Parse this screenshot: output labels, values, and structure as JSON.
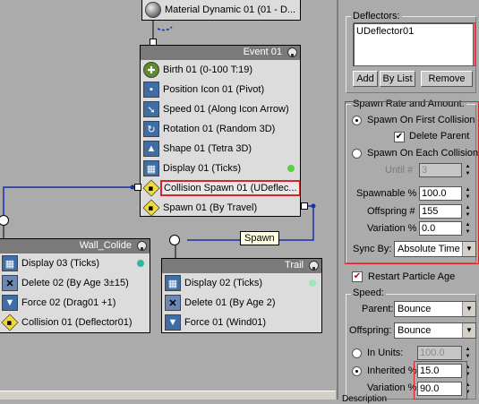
{
  "canvas": {
    "top_node": {
      "label": "Material Dynamic 01 (01 - D..."
    },
    "event_node": {
      "title": "Event 01",
      "operators": [
        {
          "label": "Birth 01 (0-100 T:19)",
          "icon": "birth-icon"
        },
        {
          "label": "Position Icon 01 (Pivot)",
          "icon": "position-icon"
        },
        {
          "label": "Speed 01 (Along Icon Arrow)",
          "icon": "speed-icon"
        },
        {
          "label": "Rotation 01 (Random 3D)",
          "icon": "rotation-icon"
        },
        {
          "label": "Shape 01 (Tetra 3D)",
          "icon": "shape-icon"
        },
        {
          "label": "Display 01 (Ticks)",
          "icon": "display-icon",
          "dot_color": "#5ccf3e"
        },
        {
          "label": "Collision Spawn 01 (UDeflec...",
          "icon": "collision-spawn-icon",
          "selected": true
        },
        {
          "label": "Spawn 01 (By Travel)",
          "icon": "spawn-icon"
        }
      ]
    },
    "wall_node": {
      "title": "Wall_Colide",
      "operators": [
        {
          "label": "Display 03 (Ticks)",
          "icon": "display-icon",
          "dot_color": "#2fb7a2"
        },
        {
          "label": "Delete 02 (By Age 3±15)",
          "icon": "delete-icon"
        },
        {
          "label": "Force 02 (Drag01 +1)",
          "icon": "force-icon"
        },
        {
          "label": "Collision 01 (Deflector01)",
          "icon": "collision-icon"
        }
      ]
    },
    "trail_node": {
      "title": "Trail",
      "operators": [
        {
          "label": "Display 02 (Ticks)",
          "icon": "display-icon",
          "dot_color": "#9be8b6"
        },
        {
          "label": "Delete 01 (By Age 2)",
          "icon": "delete-icon"
        },
        {
          "label": "Force 01 (Wind01)",
          "icon": "force-icon"
        }
      ]
    },
    "tooltip": "Spawn"
  },
  "panel": {
    "deflectors": {
      "title": "Deflectors:",
      "items": [
        "UDeflector01"
      ],
      "add_label": "Add",
      "by_list_label": "By List",
      "remove_label": "Remove"
    },
    "spawn_rate": {
      "title": "Spawn Rate and Amount:",
      "first_collision_label": "Spawn On First Collision",
      "delete_parent_label": "Delete Parent",
      "each_collision_label": "Spawn On Each Collision",
      "until_label": "Until #",
      "until_value": "3",
      "spawnable_label": "Spawnable %",
      "spawnable_value": "100.0",
      "offspring_label": "Offspring #",
      "offspring_value": "155",
      "variation_label": "Variation %",
      "variation_value": "0.0",
      "sync_label": "Sync By:",
      "sync_value": "Absolute Time"
    },
    "restart_label": "Restart Particle Age",
    "speed": {
      "title": "Speed:",
      "parent_label": "Parent:",
      "parent_value": "Bounce",
      "offspring_label": "Offspring:",
      "offspring_value": "Bounce",
      "in_units_label": "In Units:",
      "in_units_value": "100.0",
      "inherited_label": "Inherited %",
      "inherited_value": "15.0",
      "variation_label": "Variation %",
      "variation_value": "90.0"
    },
    "description_label": "Description"
  }
}
